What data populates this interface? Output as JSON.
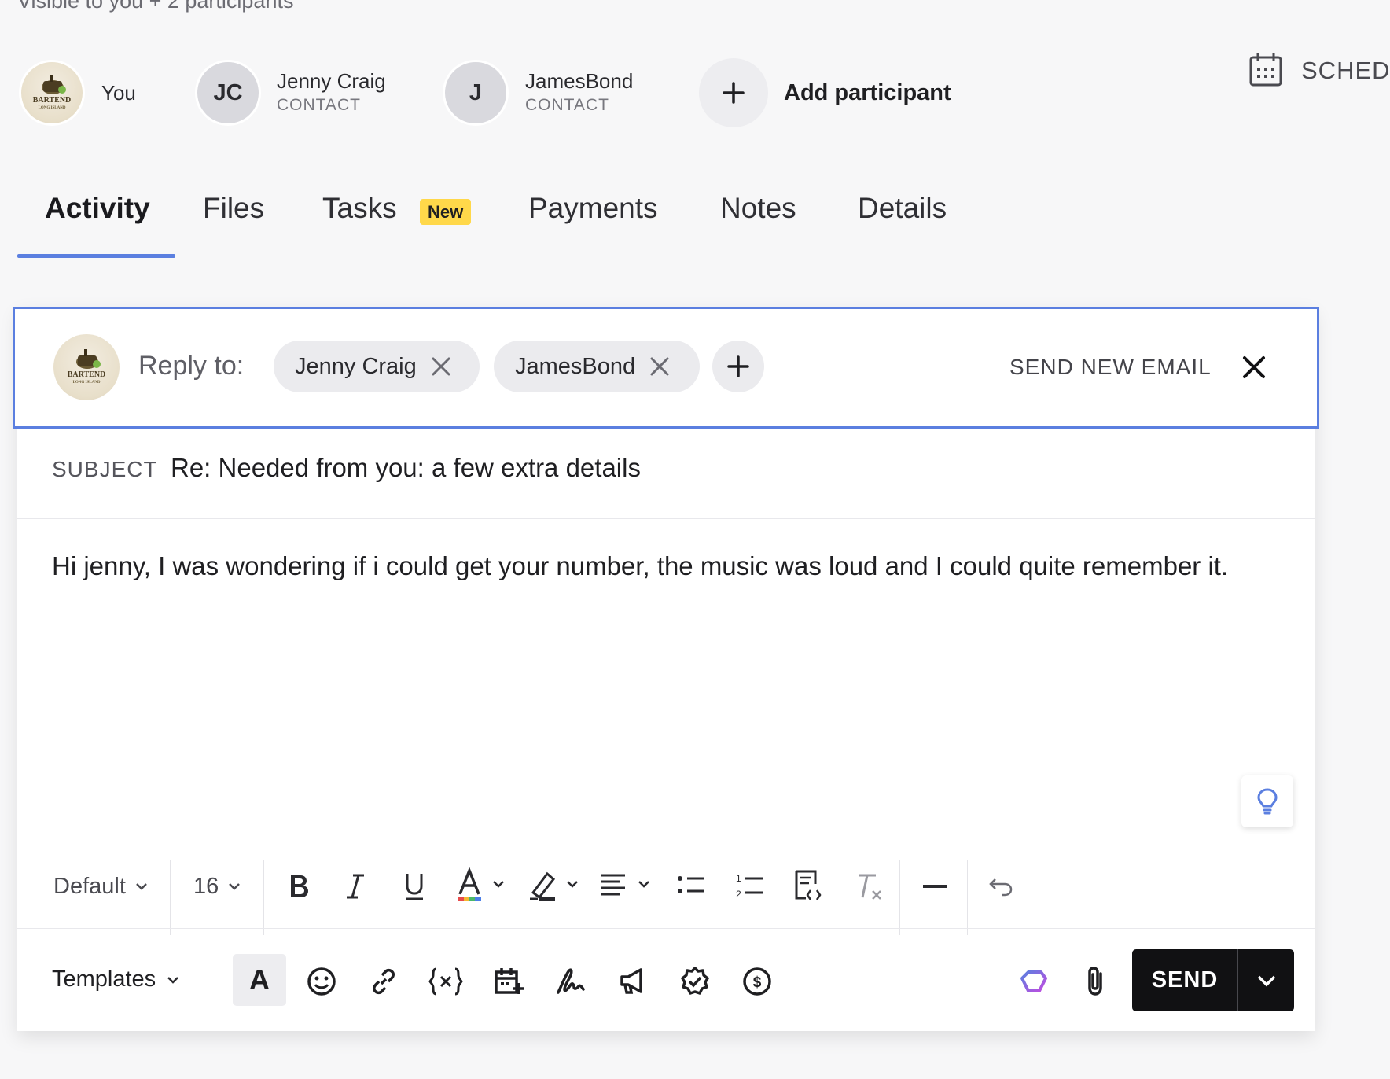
{
  "visibility": "Visible to you + 2 participants",
  "participants": [
    {
      "name": "You",
      "initials": "",
      "role": ""
    },
    {
      "name": "Jenny Craig",
      "initials": "JC",
      "role": "CONTACT"
    },
    {
      "name": "JamesBond",
      "initials": "J",
      "role": "CONTACT"
    }
  ],
  "add_participant": "Add participant",
  "schedule_label": "SCHED",
  "tabs": [
    {
      "label": "Activity",
      "active": true
    },
    {
      "label": "Files"
    },
    {
      "label": "Tasks",
      "badge": "New"
    },
    {
      "label": "Payments"
    },
    {
      "label": "Notes"
    },
    {
      "label": "Details"
    }
  ],
  "composer": {
    "reply_to_label": "Reply to:",
    "recipients": [
      "Jenny Craig",
      "JamesBond"
    ],
    "send_new_email": "SEND NEW EMAIL",
    "subject_label": "SUBJECT",
    "subject_value": "Re: Needed from you: a few extra details",
    "body": "Hi jenny, I was wondering if i could get your number, the music was loud and I could quite remember it."
  },
  "format_toolbar": {
    "font": "Default",
    "size": "16"
  },
  "bottom_toolbar": {
    "templates": "Templates",
    "text_style": "A",
    "send": "SEND"
  },
  "colors": {
    "accent": "#5b7fe0",
    "badge": "#ffd84a",
    "send_bg": "#111113"
  }
}
